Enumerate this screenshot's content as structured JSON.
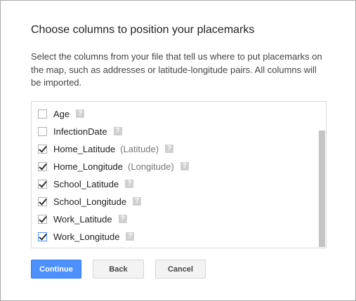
{
  "dialog": {
    "title": "Choose columns to position your placemarks",
    "description": "Select the columns from your file that tell us where to put placemarks on the map, such as addresses or latitude-longitude pairs. All columns will be imported."
  },
  "columns": [
    {
      "name": "Age",
      "type": "",
      "checked": false
    },
    {
      "name": "InfectionDate",
      "type": "",
      "checked": false
    },
    {
      "name": "Home_Latitude",
      "type": "(Latitude)",
      "checked": true
    },
    {
      "name": "Home_Longitude",
      "type": "(Longitude)",
      "checked": true
    },
    {
      "name": "School_Latitude",
      "type": "",
      "checked": true
    },
    {
      "name": "School_Longitude",
      "type": "",
      "checked": true
    },
    {
      "name": "Work_Latitude",
      "type": "",
      "checked": true
    },
    {
      "name": "Work_Longitude",
      "type": "",
      "checked": true,
      "focused": true
    }
  ],
  "help_glyph": "?",
  "buttons": {
    "continue": "Continue",
    "back": "Back",
    "cancel": "Cancel"
  }
}
